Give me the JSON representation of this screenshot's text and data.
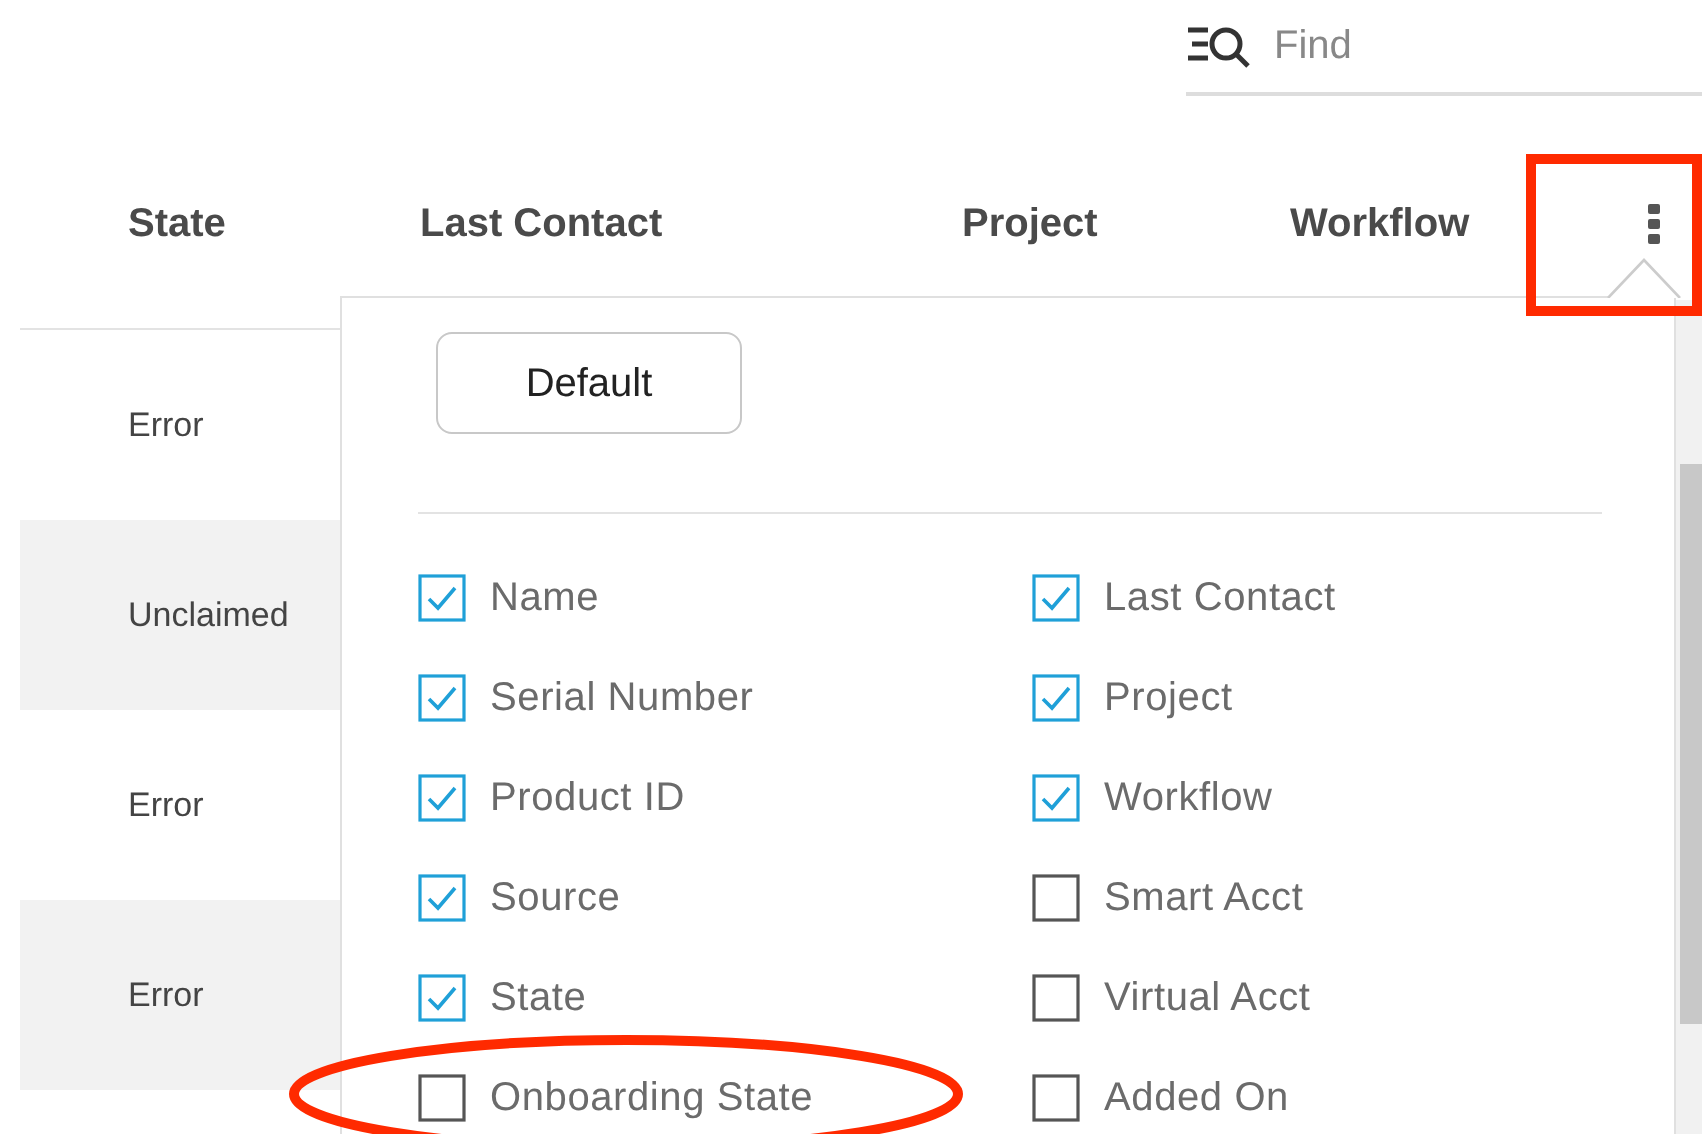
{
  "search": {
    "placeholder": "Find"
  },
  "table": {
    "columns": [
      {
        "label": "State"
      },
      {
        "label": "Last Contact"
      },
      {
        "label": "Project"
      },
      {
        "label": "Workflow"
      }
    ],
    "menu_button_highlighted": true,
    "rows": [
      {
        "state": "Error"
      },
      {
        "state": "Unclaimed"
      },
      {
        "state": "Error"
      },
      {
        "state": "Error"
      }
    ]
  },
  "column_menu": {
    "reset_button": "Default",
    "options": [
      {
        "label": "Name",
        "checked": true,
        "highlighted": false
      },
      {
        "label": "Serial Number",
        "checked": true,
        "highlighted": false
      },
      {
        "label": "Product ID",
        "checked": true,
        "highlighted": false
      },
      {
        "label": "Source",
        "checked": true,
        "highlighted": false
      },
      {
        "label": "State",
        "checked": true,
        "highlighted": false
      },
      {
        "label": "Onboarding State",
        "checked": false,
        "highlighted": true
      },
      {
        "label": "Last Contact",
        "checked": true,
        "highlighted": false
      },
      {
        "label": "Project",
        "checked": true,
        "highlighted": false
      },
      {
        "label": "Workflow",
        "checked": true,
        "highlighted": false
      },
      {
        "label": "Smart Acct",
        "checked": false,
        "highlighted": false
      },
      {
        "label": "Virtual Acct",
        "checked": false,
        "highlighted": false
      },
      {
        "label": "Added On",
        "checked": false,
        "highlighted": false
      }
    ]
  }
}
